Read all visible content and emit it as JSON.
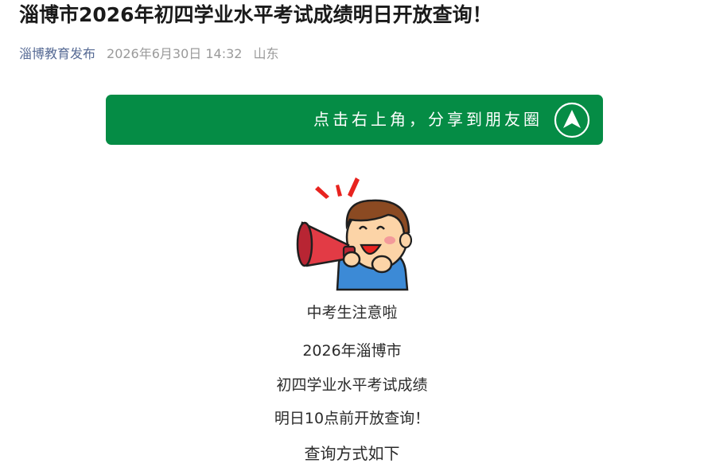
{
  "article": {
    "title": "淄博市2026年初四学业水平考试成绩明日开放查询！",
    "account_name": "淄博教育发布",
    "publish_date": "2026年6月30日 14:32",
    "location": "山东"
  },
  "share_banner": {
    "text": "点击右上角，分享到朋友圈",
    "background_color": "#058c45",
    "icon": "navigation-arrow-icon"
  },
  "illustration": {
    "icon": "megaphone-boy-icon"
  },
  "body": {
    "lines": [
      "中考生注意啦",
      "2026年淄博市",
      "初四学业水平考试成绩",
      "明日10点前开放查询！",
      "查询方式如下"
    ]
  }
}
